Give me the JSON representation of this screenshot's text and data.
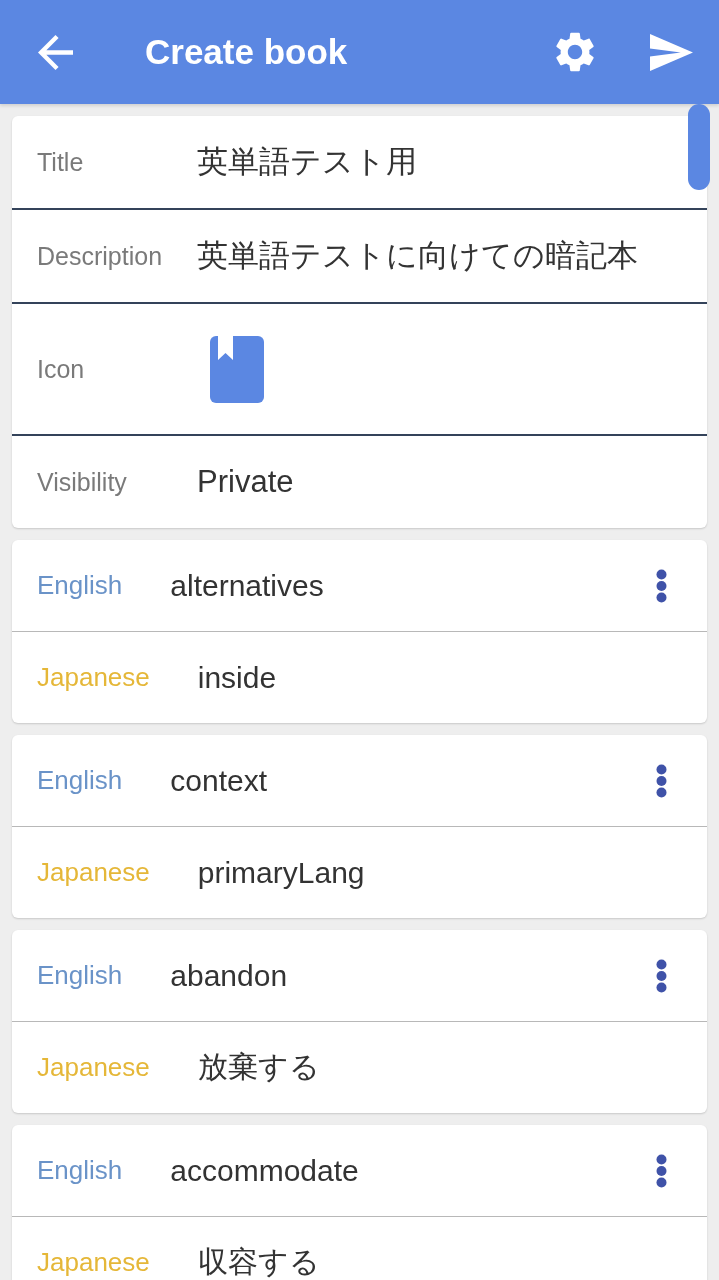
{
  "app_bar": {
    "title": "Create book"
  },
  "book": {
    "fields": [
      {
        "kind": "text",
        "label": "Title",
        "value": "英単語テスト用"
      },
      {
        "kind": "text",
        "label": "Description",
        "value": "英単語テストに向けての暗記本"
      },
      {
        "kind": "icon",
        "label": "Icon"
      },
      {
        "kind": "select",
        "label": "Visibility",
        "value": "Private"
      }
    ]
  },
  "words": [
    {
      "rows": [
        {
          "kind": "english",
          "label": "English",
          "value": "alternatives"
        },
        {
          "kind": "japanese",
          "label": "Japanese",
          "value": "inside"
        }
      ]
    },
    {
      "rows": [
        {
          "kind": "english",
          "label": "English",
          "value": "context"
        },
        {
          "kind": "japanese",
          "label": "Japanese",
          "value": "primaryLang"
        }
      ]
    },
    {
      "rows": [
        {
          "kind": "english",
          "label": "English",
          "value": "abandon"
        },
        {
          "kind": "japanese",
          "label": "Japanese",
          "value": "放棄する"
        }
      ]
    },
    {
      "rows": [
        {
          "kind": "english",
          "label": "English",
          "value": "accommodate"
        },
        {
          "kind": "japanese",
          "label": "Japanese",
          "value": "収容する"
        }
      ]
    }
  ]
}
